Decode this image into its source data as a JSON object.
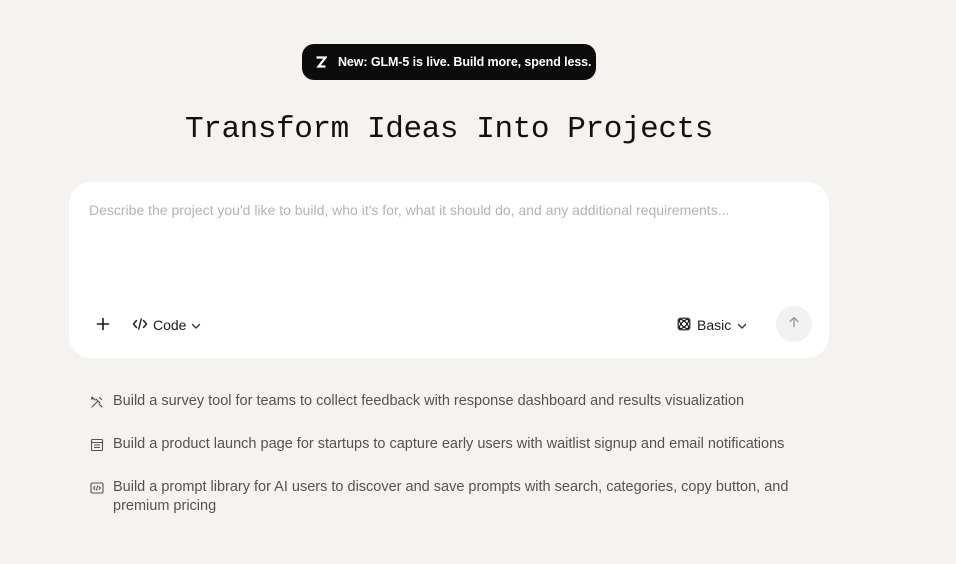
{
  "announcement": {
    "logo_letter": "Z",
    "text": "New: GLM-5 is live. Build more, spend less."
  },
  "headline": "Transform Ideas Into Projects",
  "composer": {
    "placeholder": "Describe the project you'd like to build, who it's for, what it should do, and any additional requirements...",
    "value": "",
    "add_icon": "plus-icon",
    "mode": {
      "label": "Code",
      "icon": "code-icon"
    },
    "tier": {
      "label": "Basic",
      "icon": "atom-icon"
    },
    "send_icon": "arrow-up-icon"
  },
  "suggestions": [
    {
      "icon": "tools-icon",
      "text": "Build a survey tool for teams to collect feedback with response dashboard and results visualization"
    },
    {
      "icon": "page-icon",
      "text": "Build a product launch page for startups to capture early users with waitlist signup and email notifications"
    },
    {
      "icon": "code-window-icon",
      "text": "Build a prompt library for AI users to discover and save prompts with search, categories, copy button, and premium pricing"
    }
  ],
  "colors": {
    "background": "#f4f3f0",
    "announcement_bg": "#0b0b0b",
    "composer_bg": "#ffffff",
    "placeholder": "#b3b3b3",
    "suggestion_text": "#555350"
  }
}
